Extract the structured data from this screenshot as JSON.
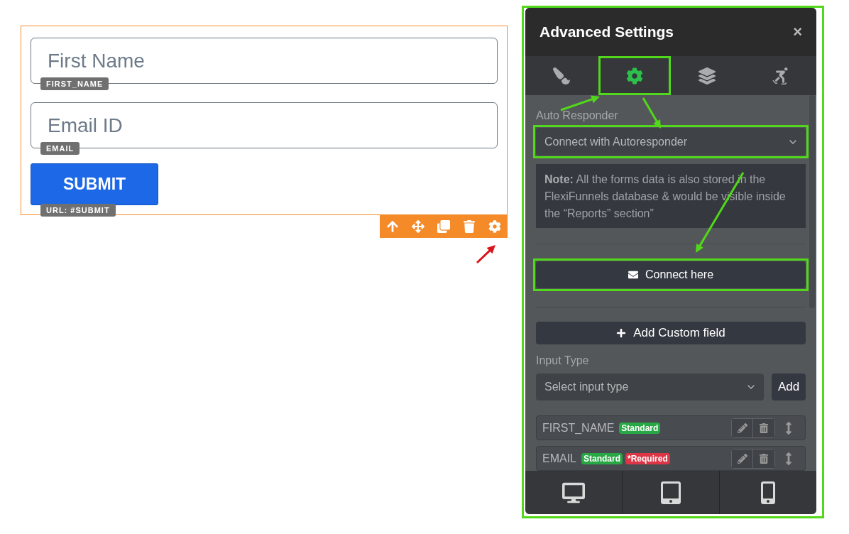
{
  "form": {
    "fields": [
      {
        "placeholder": "First Name",
        "tag": "FIRST_NAME"
      },
      {
        "placeholder": "Email ID",
        "tag": "EMAIL"
      }
    ],
    "submit": {
      "label": "SUBMIT",
      "tag": "URL: #SUBMIT"
    },
    "toolbar": [
      {
        "kind": "up"
      },
      {
        "kind": "move"
      },
      {
        "kind": "duplicate"
      },
      {
        "kind": "delete"
      },
      {
        "kind": "settings"
      }
    ]
  },
  "panel": {
    "title": "Advanced Settings",
    "close": "×",
    "highlighted": true,
    "tabs": [
      {
        "kind": "style",
        "selected": false,
        "highlighted": false
      },
      {
        "kind": "settings",
        "selected": true,
        "highlighted": true
      },
      {
        "kind": "layers",
        "selected": false,
        "highlighted": false
      },
      {
        "kind": "animation",
        "selected": false,
        "highlighted": false
      }
    ],
    "auto_responder": {
      "label": "Auto Responder",
      "value": "Connect with Autoresponder",
      "highlighted": true
    },
    "note": "**Note:** All the forms data is also stored in the FlexiFunnels database & would be visible inside the “Reports” section”",
    "connect_button": {
      "label": "Connect here",
      "highlighted": true
    },
    "add_custom_field": "Add Custom field",
    "input_type": {
      "label": "Input Type",
      "placeholder": "Select input type",
      "button": "Add"
    },
    "fields": [
      {
        "name": "FIRST_NAME",
        "badges": [
          {
            "text": "Standard",
            "color": "#28a745"
          }
        ]
      },
      {
        "name": "EMAIL",
        "badges": [
          {
            "text": "Standard",
            "color": "#28a745"
          },
          {
            "text": "*Required",
            "color": "#dc3545"
          }
        ]
      }
    ],
    "devices": [
      {
        "kind": "desktop"
      },
      {
        "kind": "tablet"
      },
      {
        "kind": "mobile"
      }
    ]
  }
}
